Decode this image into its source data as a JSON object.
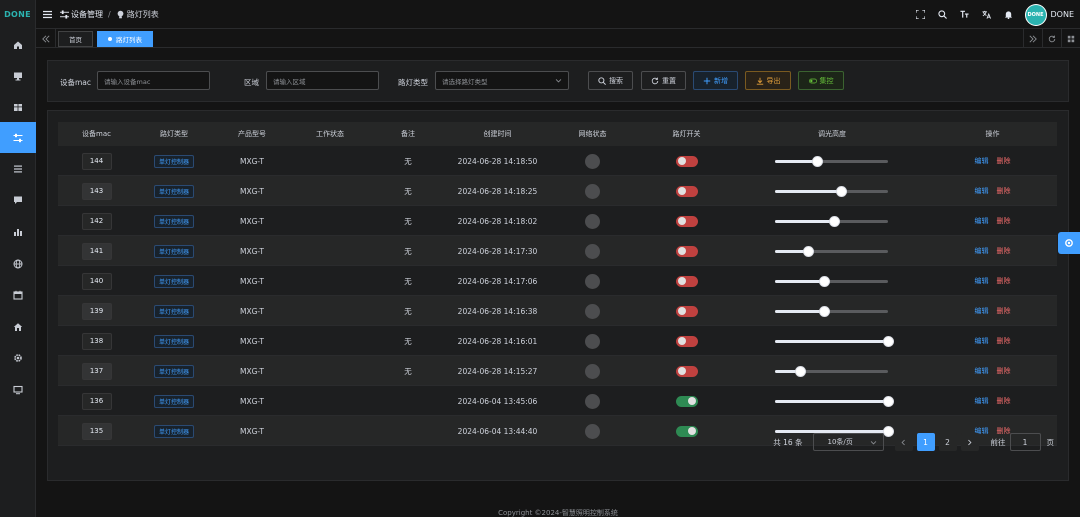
{
  "app": {
    "logo": "DONE",
    "user_name": "DONE",
    "avatar_text": "DONE"
  },
  "colors": {
    "primary": "#409eff",
    "danger": "#f56c6c",
    "warning": "#e6a23c",
    "success": "#67c23a",
    "brand": "#2bb3b0"
  },
  "sidebar": {
    "items": [
      {
        "icon": "home-icon"
      },
      {
        "icon": "monitor-icon"
      },
      {
        "icon": "box-icon"
      },
      {
        "icon": "sliders-icon",
        "active": true
      },
      {
        "icon": "list-icon"
      },
      {
        "icon": "message-icon"
      },
      {
        "icon": "bar-chart-icon"
      },
      {
        "icon": "globe-icon"
      },
      {
        "icon": "calendar-icon"
      },
      {
        "icon": "house-icon"
      },
      {
        "icon": "gear-icon"
      },
      {
        "icon": "desktop-icon"
      }
    ]
  },
  "breadcrumb": {
    "parent": "设备管理",
    "separator": "/",
    "current": "路灯列表"
  },
  "tabs": [
    {
      "label": "首页"
    },
    {
      "label": "路灯列表",
      "active": true
    }
  ],
  "filters": {
    "mac_label": "设备mac",
    "mac_placeholder": "请输入设备mac",
    "area_label": "区域",
    "area_placeholder": "请输入区域",
    "type_label": "路灯类型",
    "type_placeholder": "请选择路灯类型",
    "search_label": "搜索",
    "reset_label": "重置",
    "add_label": "新增",
    "export_label": "导出",
    "control_label": "集控"
  },
  "table": {
    "columns": [
      "设备mac",
      "路灯类型",
      "产品型号",
      "工作状态",
      "备注",
      "创建时间",
      "网络状态",
      "路灯开关",
      "调光高度",
      "操作"
    ],
    "rows": [
      {
        "mac": "144",
        "type": "单灯控制器",
        "model": "MXG-T",
        "status": "",
        "remark": "无",
        "created": "2024-06-28 14:18:50",
        "switch_on": false,
        "dim": 0.37
      },
      {
        "mac": "143",
        "type": "单灯控制器",
        "model": "MXG-T",
        "status": "",
        "remark": "无",
        "created": "2024-06-28 14:18:25",
        "switch_on": false,
        "dim": 0.58
      },
      {
        "mac": "142",
        "type": "单灯控制器",
        "model": "MXG-T",
        "status": "",
        "remark": "无",
        "created": "2024-06-28 14:18:02",
        "switch_on": false,
        "dim": 0.52
      },
      {
        "mac": "141",
        "type": "单灯控制器",
        "model": "MXG-T",
        "status": "",
        "remark": "无",
        "created": "2024-06-28 14:17:30",
        "switch_on": false,
        "dim": 0.29
      },
      {
        "mac": "140",
        "type": "单灯控制器",
        "model": "MXG-T",
        "status": "",
        "remark": "无",
        "created": "2024-06-28 14:17:06",
        "switch_on": false,
        "dim": 0.43
      },
      {
        "mac": "139",
        "type": "单灯控制器",
        "model": "MXG-T",
        "status": "",
        "remark": "无",
        "created": "2024-06-28 14:16:38",
        "switch_on": false,
        "dim": 0.43
      },
      {
        "mac": "138",
        "type": "单灯控制器",
        "model": "MXG-T",
        "status": "",
        "remark": "无",
        "created": "2024-06-28 14:16:01",
        "switch_on": false,
        "dim": 1.0
      },
      {
        "mac": "137",
        "type": "单灯控制器",
        "model": "MXG-T",
        "status": "",
        "remark": "无",
        "created": "2024-06-28 14:15:27",
        "switch_on": false,
        "dim": 0.22
      },
      {
        "mac": "136",
        "type": "单灯控制器",
        "model": "MXG-T",
        "status": "",
        "remark": "",
        "created": "2024-06-04 13:45:06",
        "switch_on": true,
        "dim": 1.0
      },
      {
        "mac": "135",
        "type": "单灯控制器",
        "model": "MXG-T",
        "status": "",
        "remark": "",
        "created": "2024-06-04 13:44:40",
        "switch_on": true,
        "dim": 1.0
      }
    ],
    "edit_label": "编辑",
    "delete_label": "删除"
  },
  "pagination": {
    "total_text": "共 16 条",
    "page_size": "10条/页",
    "pages": [
      "1",
      "2"
    ],
    "current_page": "1",
    "goto_label": "前往",
    "goto_value": "1",
    "page_unit": "页"
  },
  "footer": {
    "copyright": "Copyright ©2024-智慧照明控制系统"
  }
}
